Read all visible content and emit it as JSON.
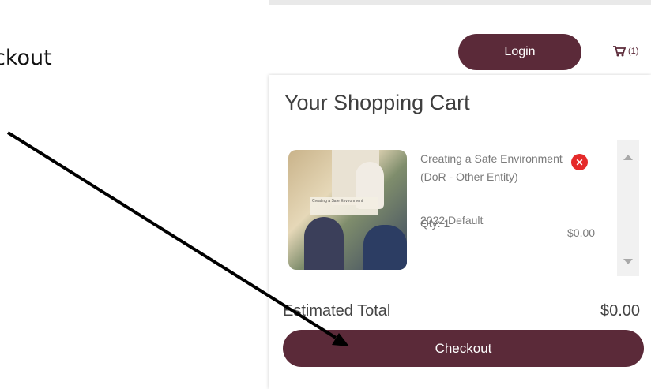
{
  "instruction_text": "ckout",
  "header": {
    "login_label": "Login",
    "cart_count": "(1)"
  },
  "cart": {
    "title": "Your Shopping Cart",
    "items": [
      {
        "name": "Creating a Safe Environment (DoR - Other Entity)",
        "variant": "2022 Default",
        "qty": "Qty: 1",
        "price": "$0.00",
        "thumbnail_label": "Creating a Safe Environment"
      }
    ],
    "estimated_total_label": "Estimated Total",
    "estimated_total_value": "$0.00",
    "checkout_label": "Checkout"
  },
  "colors": {
    "brand": "#5b2a39",
    "remove": "#e52a2a",
    "annotation_arrow": "#000000"
  },
  "icons": {
    "cart": "cart-icon",
    "remove": "remove-x-icon"
  }
}
